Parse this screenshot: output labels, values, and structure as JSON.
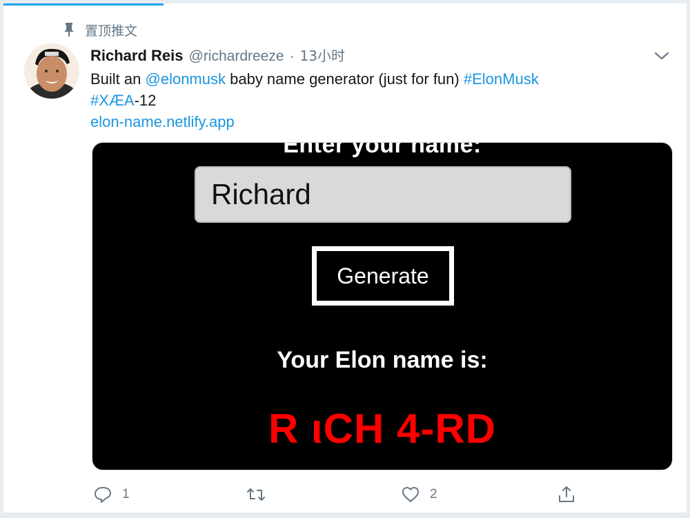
{
  "pinned": {
    "label": "置顶推文"
  },
  "author": {
    "name": "Richard Reis",
    "handle": "@richardreeze",
    "separator": "·",
    "time": "13小时"
  },
  "tweet": {
    "text_before": "Built an ",
    "mention": "@elonmusk",
    "text_middle": " baby name generator (just for fun) ",
    "hashtag1": "#ElonMusk",
    "hashtag2": "#XÆA",
    "text_after": "-12",
    "link": "elon-name.netlify.app"
  },
  "media": {
    "heading": "Enter your name:",
    "input_value": "Richard",
    "button_label": "Generate",
    "result_label": "Your Elon name is:",
    "result_name": "R ιCH 4-RD",
    "colors": {
      "background": "#000000",
      "result": "#ff0000"
    }
  },
  "actions": {
    "reply_count": "1",
    "retweet_count": "",
    "like_count": "2"
  },
  "colors": {
    "accent": "#1da1f2",
    "link": "#1b95e0",
    "muted": "#657786"
  }
}
